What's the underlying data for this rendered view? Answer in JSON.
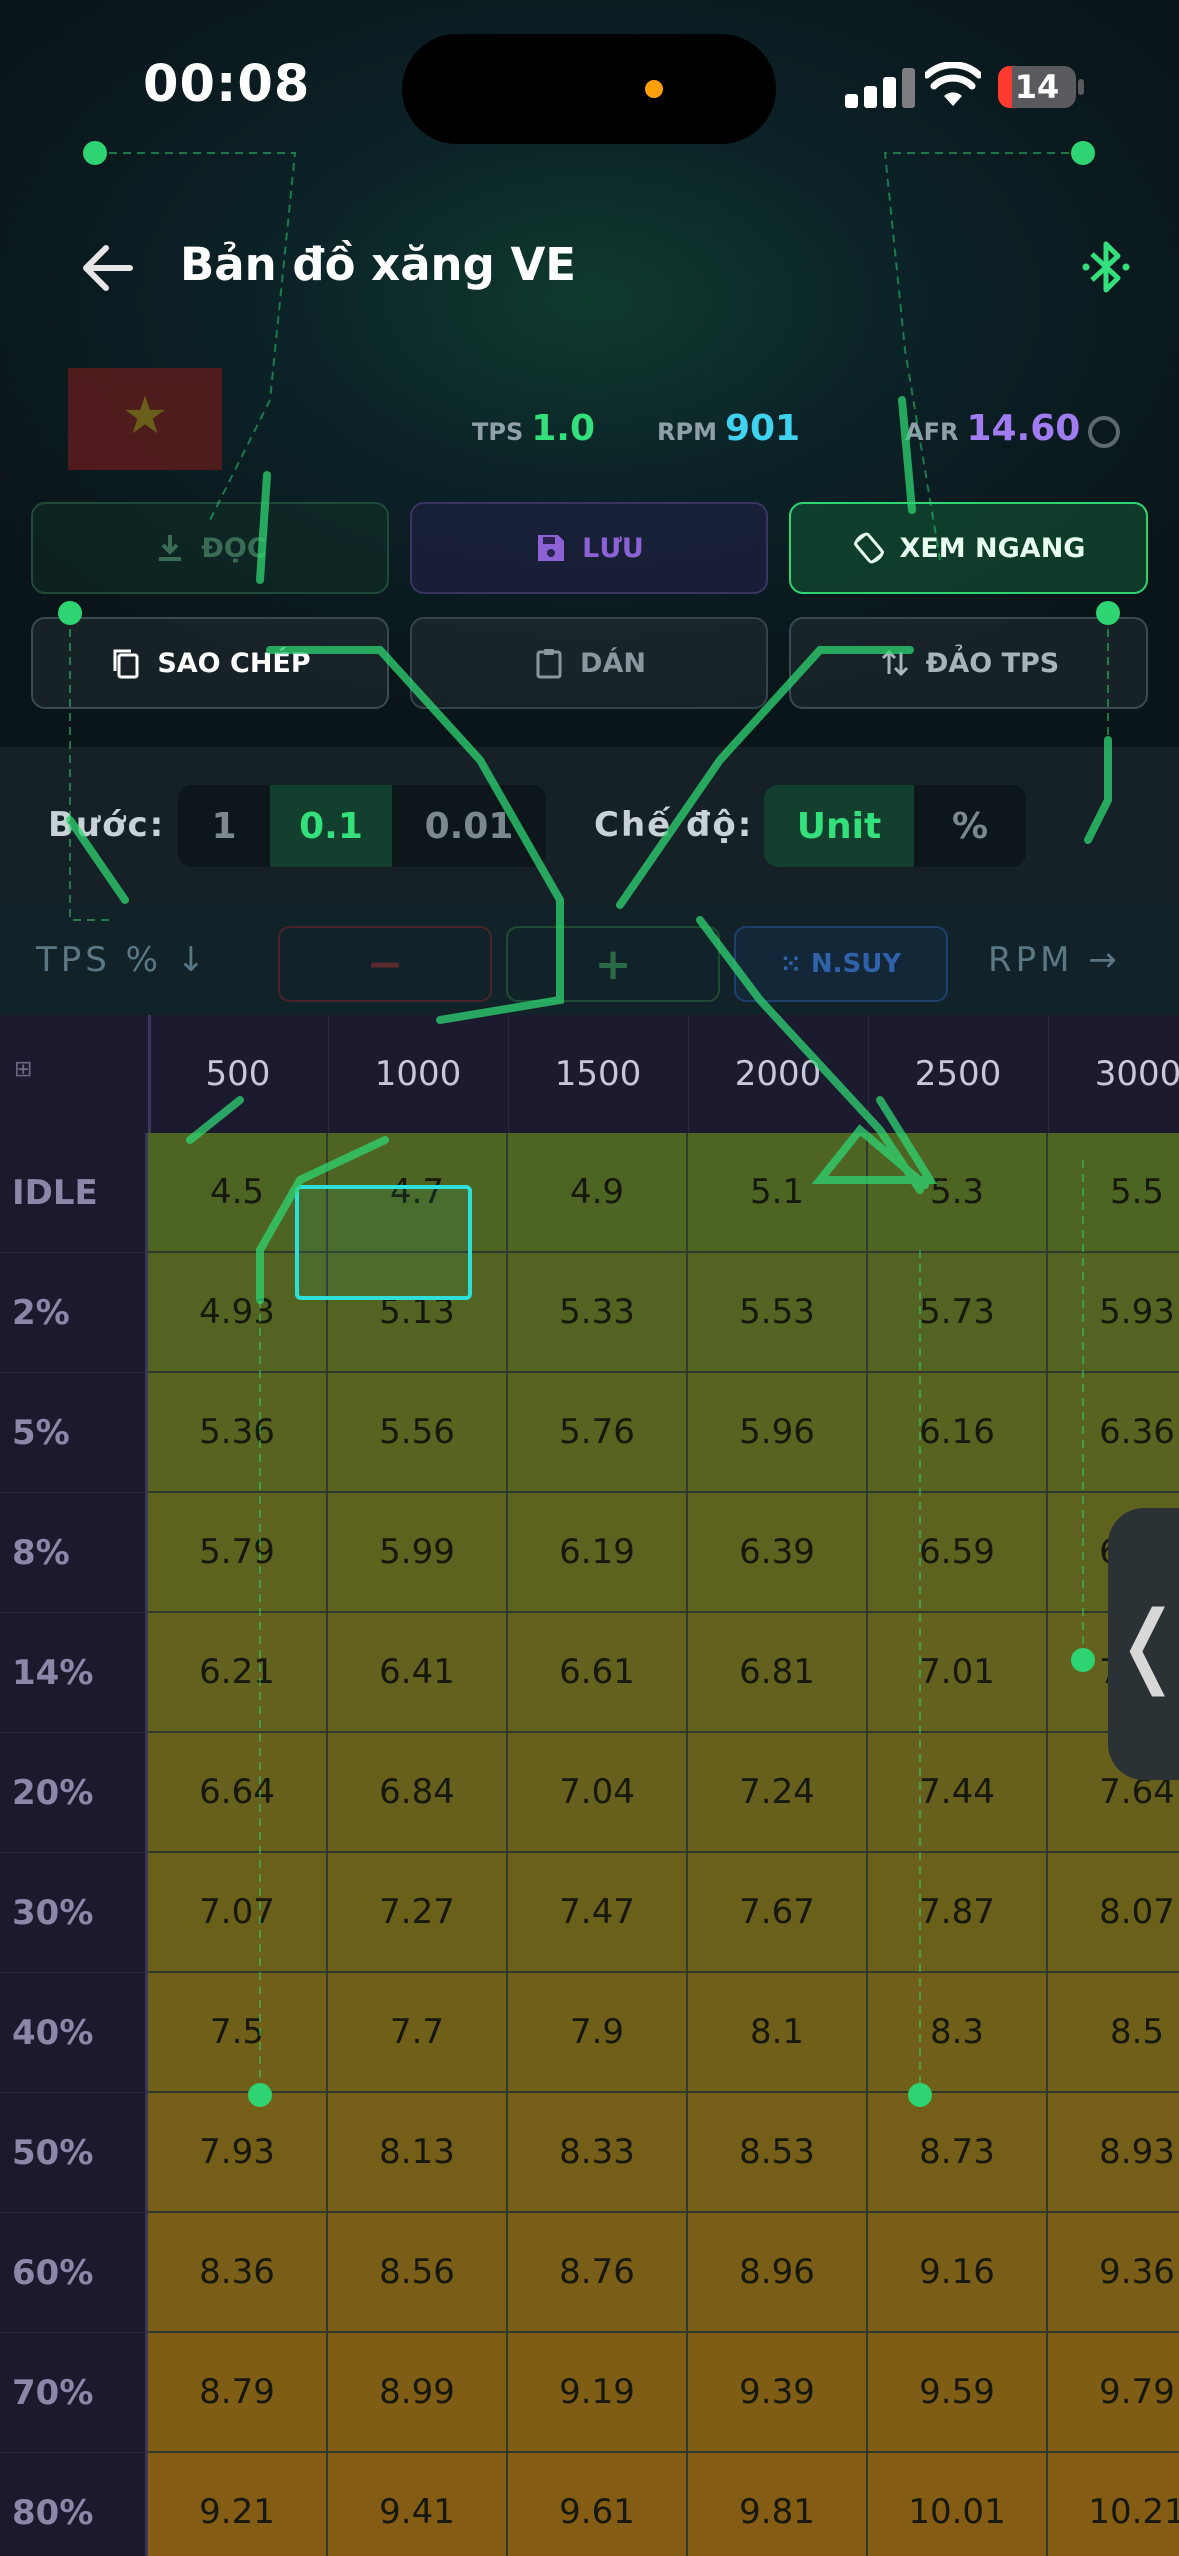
{
  "status": {
    "time": "00:08",
    "battery": "14"
  },
  "header": {
    "title": "Bản đồ xăng VE"
  },
  "live": {
    "tps_label": "TPS",
    "tps_value": "1.0",
    "rpm_label": "RPM",
    "rpm_value": "901",
    "afr_label": "AFR",
    "afr_value": "14.60"
  },
  "actions": {
    "read": "ĐỌC",
    "save": "LƯU",
    "landscape": "XEM NGANG",
    "copy": "SAO CHÉP",
    "paste": "DÁN",
    "invert_tps": "ĐẢO TPS"
  },
  "step": {
    "label": "Bước:",
    "options": [
      "1",
      "0.1",
      "0.01"
    ],
    "selected": "0.1"
  },
  "mode": {
    "label": "Chế độ:",
    "options": [
      "Unit",
      "%"
    ],
    "selected": "Unit"
  },
  "axis": {
    "tps_label": "TPS %",
    "rpm_label": "RPM",
    "minus": "−",
    "plus": "+",
    "interp": "N.SUY"
  },
  "table": {
    "corner_icon": "⊞",
    "rpm": [
      "500",
      "1000",
      "1500",
      "2000",
      "2500",
      "3000"
    ],
    "tps": [
      "IDLE",
      "2%",
      "5%",
      "8%",
      "14%",
      "20%",
      "30%",
      "40%",
      "50%",
      "60%",
      "70%",
      "80%"
    ],
    "values": [
      [
        "4.5",
        "4.7",
        "4.9",
        "5.1",
        "5.3",
        "5.5"
      ],
      [
        "4.93",
        "5.13",
        "5.33",
        "5.53",
        "5.73",
        "5.93"
      ],
      [
        "5.36",
        "5.56",
        "5.76",
        "5.96",
        "6.16",
        "6.36"
      ],
      [
        "5.79",
        "5.99",
        "6.19",
        "6.39",
        "6.59",
        "6.79"
      ],
      [
        "6.21",
        "6.41",
        "6.61",
        "6.81",
        "7.01",
        "7.21"
      ],
      [
        "6.64",
        "6.84",
        "7.04",
        "7.24",
        "7.44",
        "7.64"
      ],
      [
        "7.07",
        "7.27",
        "7.47",
        "7.67",
        "7.87",
        "8.07"
      ],
      [
        "7.5",
        "7.7",
        "7.9",
        "8.1",
        "8.3",
        "8.5"
      ],
      [
        "7.93",
        "8.13",
        "8.33",
        "8.53",
        "8.73",
        "8.93"
      ],
      [
        "8.36",
        "8.56",
        "8.76",
        "8.96",
        "9.16",
        "9.36"
      ],
      [
        "8.79",
        "8.99",
        "9.19",
        "9.39",
        "9.59",
        "9.79"
      ],
      [
        "9.21",
        "9.41",
        "9.61",
        "9.81",
        "10.01",
        "10.21"
      ]
    ],
    "selected_cell": {
      "row": 0,
      "col": 1
    }
  },
  "side_tab": "❬",
  "colors": {
    "accent_green": "#33e07b",
    "cyan": "#2ee0da",
    "purple": "#8d62d6",
    "afr": "#a07cf0"
  }
}
